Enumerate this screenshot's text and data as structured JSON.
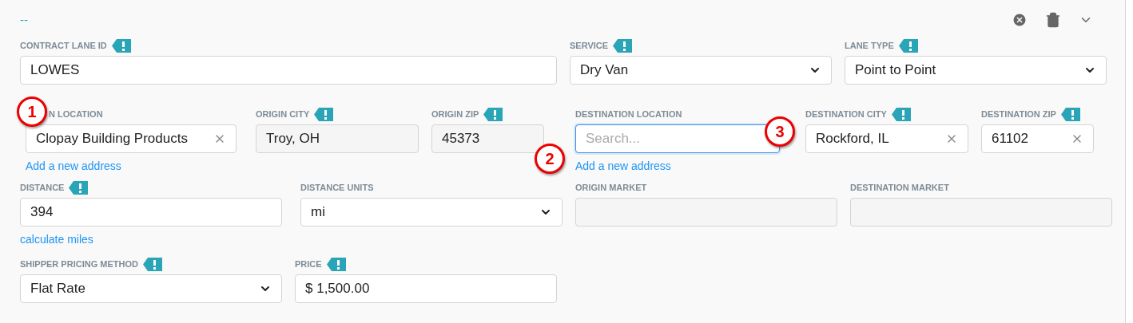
{
  "header": {
    "title": "--"
  },
  "rows": [
    {
      "fields": [
        {
          "label": "CONTRACT LANE ID",
          "flagged": true,
          "kind": "text",
          "value": "LOWES"
        },
        {
          "label": "SERVICE",
          "flagged": true,
          "kind": "select",
          "value": "Dry Van"
        },
        {
          "label": "LANE TYPE",
          "flagged": true,
          "kind": "select",
          "value": "Point to Point"
        }
      ]
    },
    {
      "fields": [
        {
          "label": "N LOCATION",
          "flagged": false,
          "kind": "clearable",
          "value": "Clopay Building Products",
          "link": "Add a new address"
        },
        {
          "label": "ORIGIN CITY",
          "flagged": true,
          "kind": "readonly",
          "value": "Troy, OH"
        },
        {
          "label": "ORIGIN ZIP",
          "flagged": true,
          "kind": "readonly",
          "value": "45373"
        },
        {
          "label": "DESTINATION LOCATION",
          "flagged": false,
          "kind": "search",
          "placeholder": "Search...",
          "focused": true,
          "link": "Add a new address"
        },
        {
          "label": "DESTINATION CITY",
          "flagged": true,
          "kind": "clearable",
          "value": "Rockford, IL"
        },
        {
          "label": "DESTINATION ZIP",
          "flagged": true,
          "kind": "clearable",
          "value": "61102"
        }
      ]
    },
    {
      "fields": [
        {
          "label": "DISTANCE",
          "flagged": true,
          "kind": "text",
          "value": "394",
          "link": "calculate miles"
        },
        {
          "label": "DISTANCE UNITS",
          "flagged": false,
          "kind": "select",
          "value": "mi"
        },
        {
          "label": "ORIGIN MARKET",
          "flagged": false,
          "kind": "readonly"
        },
        {
          "label": "DESTINATION MARKET",
          "flagged": false,
          "kind": "readonly"
        }
      ]
    },
    {
      "fields": [
        {
          "label": "SHIPPER PRICING METHOD",
          "flagged": true,
          "kind": "select",
          "value": "Flat Rate"
        },
        {
          "label": "PRICE",
          "flagged": true,
          "kind": "text",
          "value": "$ 1,500.00"
        }
      ]
    }
  ],
  "callouts": [
    {
      "number": "1"
    },
    {
      "number": "2"
    },
    {
      "number": "3"
    }
  ]
}
